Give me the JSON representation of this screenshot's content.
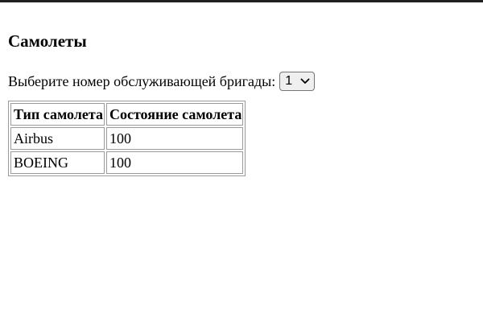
{
  "page": {
    "title": "Самолеты"
  },
  "brigade_selector": {
    "label": "Выберите номер обслуживающей бригады:",
    "selected_value": "1",
    "icon": "chevron-down-icon"
  },
  "table": {
    "headers": [
      "Тип самолета",
      "Состояние самолета"
    ],
    "rows": [
      [
        "Airbus",
        "100"
      ],
      [
        "BOEING",
        "100"
      ]
    ]
  }
}
